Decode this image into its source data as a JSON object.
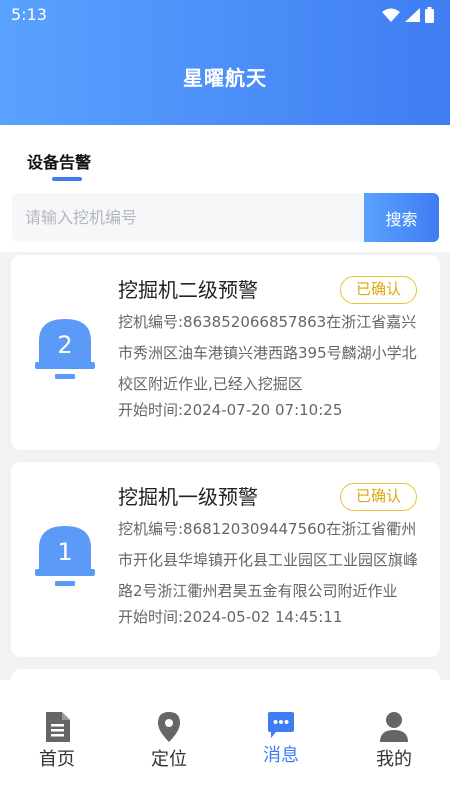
{
  "status_bar": {
    "time": "5:13"
  },
  "header": {
    "title": "星曜航天"
  },
  "tab": {
    "label": "设备告警"
  },
  "search": {
    "placeholder": "请输入挖机编号",
    "value": "",
    "button_label": "搜索"
  },
  "alerts": [
    {
      "level": "2",
      "title": "挖掘机二级预警",
      "status": "已确认",
      "description": "挖机编号:863852066857863在浙江省嘉兴市秀洲区油车港镇兴港西路395号麟湖小学北校区附近作业,已经入挖掘区",
      "start_time": "开始时间:2024-07-20 07:10:25"
    },
    {
      "level": "1",
      "title": "挖掘机一级预警",
      "status": "已确认",
      "description": "挖机编号:868120309447560在浙江省衢州市开化县华埠镇开化县工业园区工业园区旗峰路2号浙江衢州君昊五金有限公司附近作业",
      "start_time": "开始时间:2024-05-02 14:45:11"
    }
  ],
  "nav": {
    "items": [
      {
        "label": "首页",
        "icon": "document-icon"
      },
      {
        "label": "定位",
        "icon": "location-pin-icon"
      },
      {
        "label": "消息",
        "icon": "message-icon",
        "active": true
      },
      {
        "label": "我的",
        "icon": "person-icon"
      }
    ]
  },
  "colors": {
    "primary": "#3f7df2",
    "header_gradient_start": "#5aa2ff",
    "badge": "#e9c33a",
    "inactive_icon": "#666666"
  }
}
